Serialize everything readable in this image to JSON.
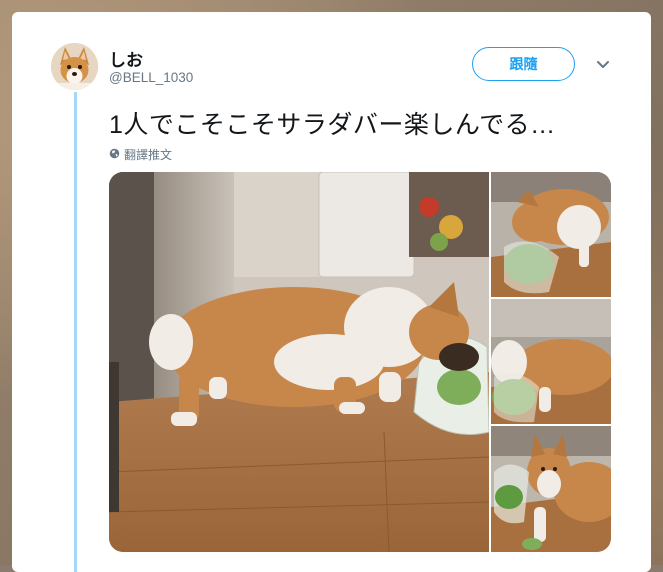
{
  "tweet": {
    "author_name": "しお",
    "author_handle": "@BELL_1030",
    "follow_label": "跟隨",
    "text": "1人でこそこそサラダバー楽しんでる…",
    "translate_label": "翻譯推文"
  },
  "icons": {
    "more": "chevron-down-icon",
    "translate": "globe-icon"
  },
  "colors": {
    "accent": "#1da1f2",
    "thread_line": "#a6d8f6"
  }
}
